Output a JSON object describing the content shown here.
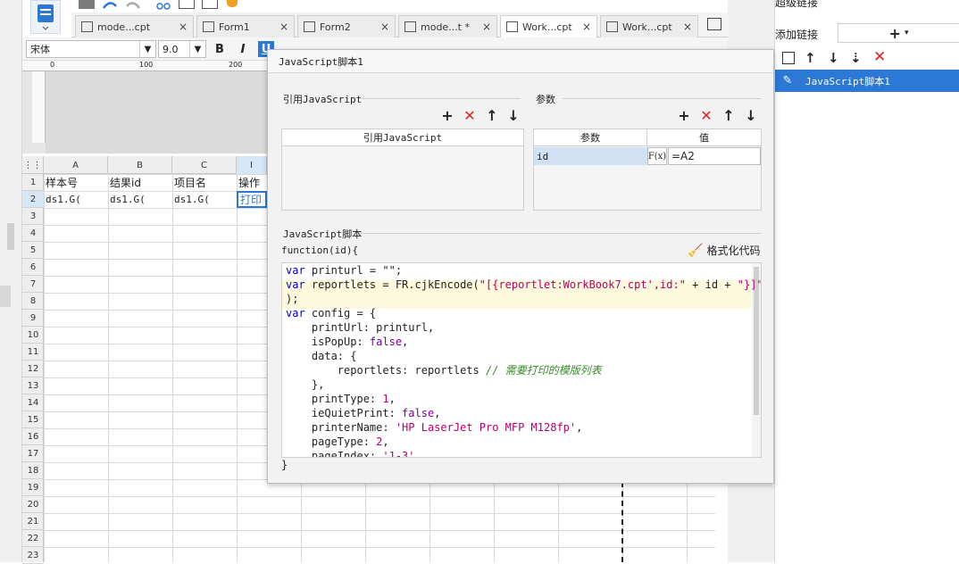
{
  "colors": {
    "accent": "#2b78d6",
    "delete": "#e02020",
    "code_keyword": "#0000cc",
    "code_string": "#b4006b",
    "code_comment": "#3a8a2a"
  },
  "tabs": [
    {
      "label": "mode...cpt",
      "close": "×"
    },
    {
      "label": "Form1",
      "close": "×"
    },
    {
      "label": "Form2",
      "close": "×"
    },
    {
      "label": "mode...t *",
      "close": "×"
    },
    {
      "label": "Work...cpt",
      "close": "×"
    },
    {
      "label": "Work...cpt",
      "close": "×"
    }
  ],
  "format_bar": {
    "font": "宋体",
    "font_size": "9.0",
    "bold": "B",
    "italic": "I",
    "underline": "U"
  },
  "ruler": {
    "marks": [
      "0",
      "100",
      "200"
    ]
  },
  "grid": {
    "columns": [
      "A",
      "B",
      "C",
      "I"
    ],
    "rows": [
      "1",
      "2",
      "3",
      "4",
      "5",
      "6",
      "7",
      "8",
      "9",
      "10",
      "11",
      "12",
      "13",
      "14",
      "15",
      "16",
      "17",
      "18",
      "19",
      "20",
      "21",
      "22",
      "23"
    ],
    "r1": [
      "样本号",
      "结果id",
      "项目名",
      "操作"
    ],
    "r2": [
      "ds1.G(",
      "ds1.G(",
      "ds1.G(",
      "打印"
    ]
  },
  "right_panel": {
    "title": "超级链接",
    "add_label": "添加链接",
    "add_btn": "+",
    "selected_item": "JavaScript脚本1"
  },
  "dialog": {
    "title": "JavaScript脚本1",
    "ref_section": "引用JavaScript",
    "ref_header": "引用JavaScript",
    "param_section": "参数",
    "param_header": "参数",
    "value_header": "值",
    "param_name": "id",
    "param_value": "=A2",
    "fx_label": "F(x)",
    "script_section": "JavaScript脚本",
    "func_sig": "function(id){",
    "format_code": "格式化代码",
    "closing_brace": "}"
  },
  "code": {
    "l1_kw": "var",
    "l1_rest": " printurl = \"\";",
    "l2_kw": "var",
    "l2_a": " reportlets = FR.cjkEncode(",
    "l2_str": "\"[{reportlet:WorkBook7.cpt',id:\"",
    "l2_b": " + id + ",
    "l2_str2": "\"}]\"",
    "l3": ");",
    "l4_kw": "var",
    "l4_rest": " config = {",
    "l5": "    printUrl: printurl,",
    "l6_a": "    isPopUp: ",
    "l6_b": "false",
    ",": ",",
    "l7": "    data: {",
    "l8_a": "        reportlets: reportlets ",
    "l8_cm": "// 需要打印的模版列表",
    "l9": "    },",
    "l10_a": "    printType: ",
    "l10_b": "1",
    "l11_a": "    ieQuietPrint: ",
    "l11_b": "false",
    "l12_a": "    printerName: ",
    "l12_str": "'HP LaserJet Pro MFP M128fp'",
    "l13_a": "    pageType: ",
    "l13_b": "2",
    "l14_a": "    pageIndex: ",
    "l14_str": "'1-3'"
  }
}
